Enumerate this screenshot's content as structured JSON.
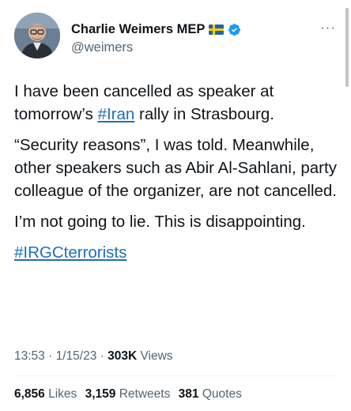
{
  "author": {
    "display_name": "Charlie Weimers MEP",
    "handle": "@weimers",
    "flag_icon": "sweden-flag-icon",
    "verified_icon": "verified-badge-icon",
    "verified_color": "#1d9bf0"
  },
  "more_button": {
    "label": "···"
  },
  "tweet": {
    "p1": {
      "before": "I have been cancelled as speaker at tomorrow’s ",
      "link": "#Iran",
      "after": " rally in Strasbourg."
    },
    "p2": "“Security reasons”, I was told. Meanwhile, other speakers such as Abir Al-Sahlani, party colleague of the organizer, are not cancelled.",
    "p3": "I’m not going to lie. This is disappointing.",
    "p4_link": "#IRGCterrorists"
  },
  "meta": {
    "time": "13:53",
    "sep1": "·",
    "date": "1/15/23",
    "sep2": "·",
    "views_count": "303K",
    "views_label": "Views"
  },
  "stats": {
    "likes_count": "6,856",
    "likes_label": "Likes",
    "retweets_count": "3,159",
    "retweets_label": "Retweets",
    "quotes_count": "381",
    "quotes_label": "Quotes"
  },
  "colors": {
    "text": "#0f1419",
    "secondary": "#536471",
    "link": "#1d6fbf"
  }
}
